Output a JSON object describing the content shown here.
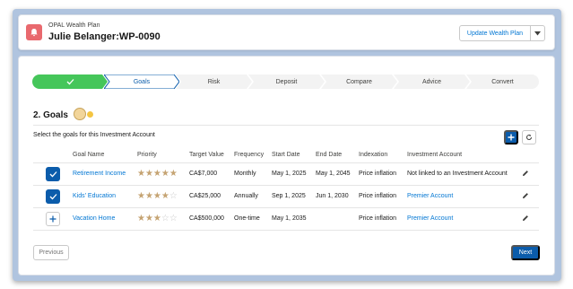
{
  "header": {
    "subtitle": "OPAL Wealth Plan",
    "title": "Julie Belanger:WP-0090",
    "update_button": "Update Wealth Plan"
  },
  "path": {
    "steps": [
      "",
      "Goals",
      "Risk",
      "Deposit",
      "Compare",
      "Advice",
      "Convert"
    ],
    "completed_color": "#45c65a",
    "current_step": "Goals"
  },
  "goals": {
    "title": "2. Goals",
    "instructions": "Select the goals for this Investment Account"
  },
  "table": {
    "headers": [
      "Goal Name",
      "Priority",
      "Target Value",
      "Frequency",
      "Start Date",
      "End Date",
      "Indexation",
      "Investment Account"
    ],
    "rows": [
      {
        "selected": true,
        "name": "Retirement Income",
        "priority": 5,
        "target": "CA$7,000",
        "frequency": "Monthly",
        "start": "May 1, 2025",
        "end": "May 1, 2045",
        "indexation": "Price inflation",
        "account": "Not linked to an Investment Account",
        "account_is_link": false
      },
      {
        "selected": true,
        "name": "Kids' Education",
        "priority": 4,
        "target": "CA$25,000",
        "frequency": "Annually",
        "start": "Sep 1, 2025",
        "end": "Jun 1, 2030",
        "indexation": "Price inflation",
        "account": "Premier Account",
        "account_is_link": true
      },
      {
        "selected": false,
        "name": "Vacation Home",
        "priority": 3,
        "target": "CA$500,000",
        "frequency": "One-time",
        "start": "May 1, 2035",
        "end": "",
        "indexation": "Price inflation",
        "account": "Premier Account",
        "account_is_link": true
      }
    ]
  },
  "footer": {
    "previous": "Previous",
    "next": "Next"
  },
  "colors": {
    "brand": "#0b5cab",
    "link": "#0176d3",
    "star": "#c5a372",
    "header_icon": "#e9696e"
  }
}
